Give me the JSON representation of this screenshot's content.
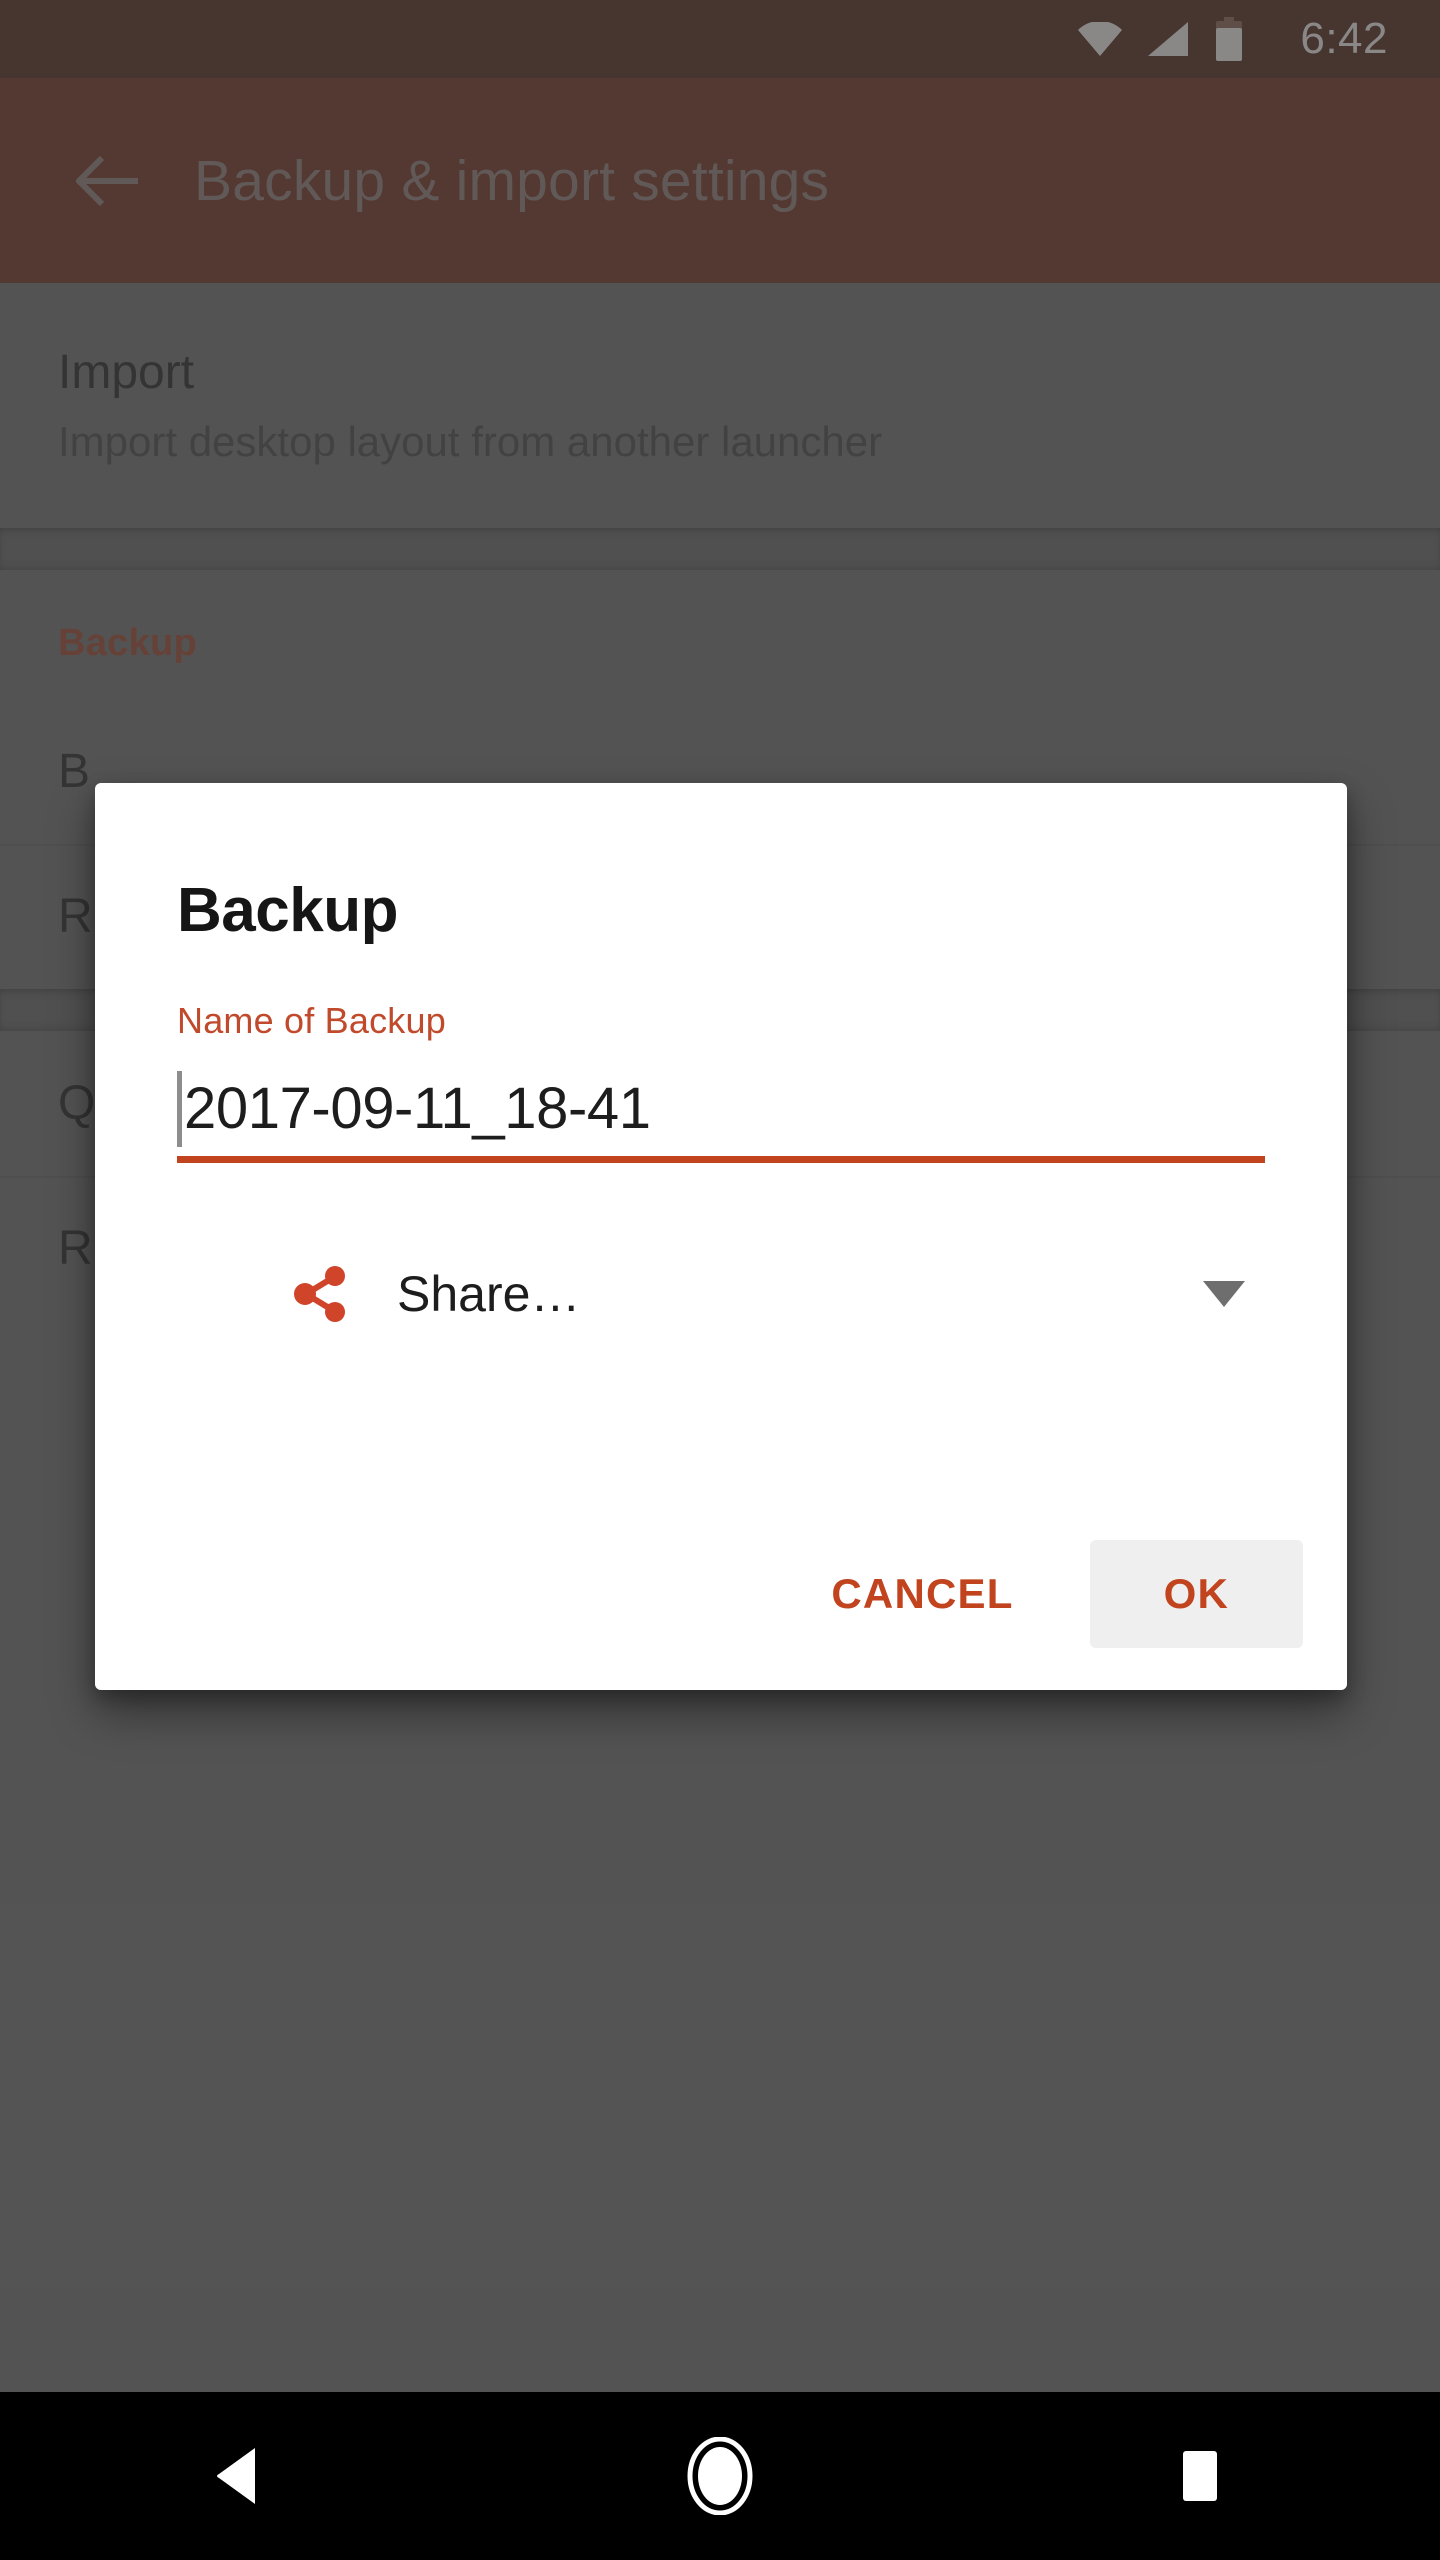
{
  "status_bar": {
    "time": "6:42",
    "icons": [
      "wifi-icon",
      "signal-icon",
      "battery-icon"
    ]
  },
  "app_bar": {
    "back_icon": "back-arrow-icon",
    "title": "Backup & import settings"
  },
  "content": {
    "import_section": {
      "title": "Import",
      "subtitle": "Import desktop layout from another launcher"
    },
    "backup_section": {
      "header": "Backup",
      "rows": [
        {
          "title": "B"
        },
        {
          "title": "R"
        },
        {
          "title": "Q"
        },
        {
          "title": "R"
        }
      ]
    }
  },
  "dialog": {
    "title": "Backup",
    "field_label": "Name of Backup",
    "field_value": "2017-09-11_18-41",
    "field_placeholder": "Name of Backup",
    "share": {
      "icon": "share-icon",
      "label": "Share…",
      "caret_icon": "chevron-down-icon"
    },
    "cancel_label": "CANCEL",
    "ok_label": "OK"
  },
  "nav_bar": {
    "back": "back-triangle-icon",
    "home": "home-circle-icon",
    "recents": "recents-square-icon"
  },
  "colors": {
    "status_bar": "#4a1b0f",
    "app_bar": "#6c2314",
    "accent": "#c1441f",
    "accent_label": "#c04a2b",
    "section_header": "#9c3c21",
    "scrim": "rgba(70,70,70,0.62)",
    "dialog_bg": "#ffffff",
    "ok_button_bg": "#efefef",
    "nav_bar": "#000000"
  }
}
